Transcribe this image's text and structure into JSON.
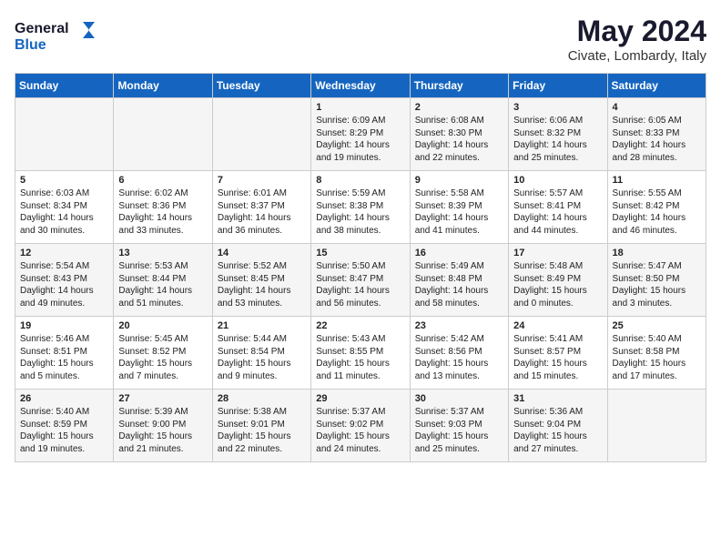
{
  "header": {
    "logo_general": "General",
    "logo_blue": "Blue",
    "month": "May 2024",
    "location": "Civate, Lombardy, Italy"
  },
  "weekdays": [
    "Sunday",
    "Monday",
    "Tuesday",
    "Wednesday",
    "Thursday",
    "Friday",
    "Saturday"
  ],
  "weeks": [
    [
      {
        "day": "",
        "info": ""
      },
      {
        "day": "",
        "info": ""
      },
      {
        "day": "",
        "info": ""
      },
      {
        "day": "1",
        "info": "Sunrise: 6:09 AM\nSunset: 8:29 PM\nDaylight: 14 hours\nand 19 minutes."
      },
      {
        "day": "2",
        "info": "Sunrise: 6:08 AM\nSunset: 8:30 PM\nDaylight: 14 hours\nand 22 minutes."
      },
      {
        "day": "3",
        "info": "Sunrise: 6:06 AM\nSunset: 8:32 PM\nDaylight: 14 hours\nand 25 minutes."
      },
      {
        "day": "4",
        "info": "Sunrise: 6:05 AM\nSunset: 8:33 PM\nDaylight: 14 hours\nand 28 minutes."
      }
    ],
    [
      {
        "day": "5",
        "info": "Sunrise: 6:03 AM\nSunset: 8:34 PM\nDaylight: 14 hours\nand 30 minutes."
      },
      {
        "day": "6",
        "info": "Sunrise: 6:02 AM\nSunset: 8:36 PM\nDaylight: 14 hours\nand 33 minutes."
      },
      {
        "day": "7",
        "info": "Sunrise: 6:01 AM\nSunset: 8:37 PM\nDaylight: 14 hours\nand 36 minutes."
      },
      {
        "day": "8",
        "info": "Sunrise: 5:59 AM\nSunset: 8:38 PM\nDaylight: 14 hours\nand 38 minutes."
      },
      {
        "day": "9",
        "info": "Sunrise: 5:58 AM\nSunset: 8:39 PM\nDaylight: 14 hours\nand 41 minutes."
      },
      {
        "day": "10",
        "info": "Sunrise: 5:57 AM\nSunset: 8:41 PM\nDaylight: 14 hours\nand 44 minutes."
      },
      {
        "day": "11",
        "info": "Sunrise: 5:55 AM\nSunset: 8:42 PM\nDaylight: 14 hours\nand 46 minutes."
      }
    ],
    [
      {
        "day": "12",
        "info": "Sunrise: 5:54 AM\nSunset: 8:43 PM\nDaylight: 14 hours\nand 49 minutes."
      },
      {
        "day": "13",
        "info": "Sunrise: 5:53 AM\nSunset: 8:44 PM\nDaylight: 14 hours\nand 51 minutes."
      },
      {
        "day": "14",
        "info": "Sunrise: 5:52 AM\nSunset: 8:45 PM\nDaylight: 14 hours\nand 53 minutes."
      },
      {
        "day": "15",
        "info": "Sunrise: 5:50 AM\nSunset: 8:47 PM\nDaylight: 14 hours\nand 56 minutes."
      },
      {
        "day": "16",
        "info": "Sunrise: 5:49 AM\nSunset: 8:48 PM\nDaylight: 14 hours\nand 58 minutes."
      },
      {
        "day": "17",
        "info": "Sunrise: 5:48 AM\nSunset: 8:49 PM\nDaylight: 15 hours\nand 0 minutes."
      },
      {
        "day": "18",
        "info": "Sunrise: 5:47 AM\nSunset: 8:50 PM\nDaylight: 15 hours\nand 3 minutes."
      }
    ],
    [
      {
        "day": "19",
        "info": "Sunrise: 5:46 AM\nSunset: 8:51 PM\nDaylight: 15 hours\nand 5 minutes."
      },
      {
        "day": "20",
        "info": "Sunrise: 5:45 AM\nSunset: 8:52 PM\nDaylight: 15 hours\nand 7 minutes."
      },
      {
        "day": "21",
        "info": "Sunrise: 5:44 AM\nSunset: 8:54 PM\nDaylight: 15 hours\nand 9 minutes."
      },
      {
        "day": "22",
        "info": "Sunrise: 5:43 AM\nSunset: 8:55 PM\nDaylight: 15 hours\nand 11 minutes."
      },
      {
        "day": "23",
        "info": "Sunrise: 5:42 AM\nSunset: 8:56 PM\nDaylight: 15 hours\nand 13 minutes."
      },
      {
        "day": "24",
        "info": "Sunrise: 5:41 AM\nSunset: 8:57 PM\nDaylight: 15 hours\nand 15 minutes."
      },
      {
        "day": "25",
        "info": "Sunrise: 5:40 AM\nSunset: 8:58 PM\nDaylight: 15 hours\nand 17 minutes."
      }
    ],
    [
      {
        "day": "26",
        "info": "Sunrise: 5:40 AM\nSunset: 8:59 PM\nDaylight: 15 hours\nand 19 minutes."
      },
      {
        "day": "27",
        "info": "Sunrise: 5:39 AM\nSunset: 9:00 PM\nDaylight: 15 hours\nand 21 minutes."
      },
      {
        "day": "28",
        "info": "Sunrise: 5:38 AM\nSunset: 9:01 PM\nDaylight: 15 hours\nand 22 minutes."
      },
      {
        "day": "29",
        "info": "Sunrise: 5:37 AM\nSunset: 9:02 PM\nDaylight: 15 hours\nand 24 minutes."
      },
      {
        "day": "30",
        "info": "Sunrise: 5:37 AM\nSunset: 9:03 PM\nDaylight: 15 hours\nand 25 minutes."
      },
      {
        "day": "31",
        "info": "Sunrise: 5:36 AM\nSunset: 9:04 PM\nDaylight: 15 hours\nand 27 minutes."
      },
      {
        "day": "",
        "info": ""
      }
    ]
  ]
}
